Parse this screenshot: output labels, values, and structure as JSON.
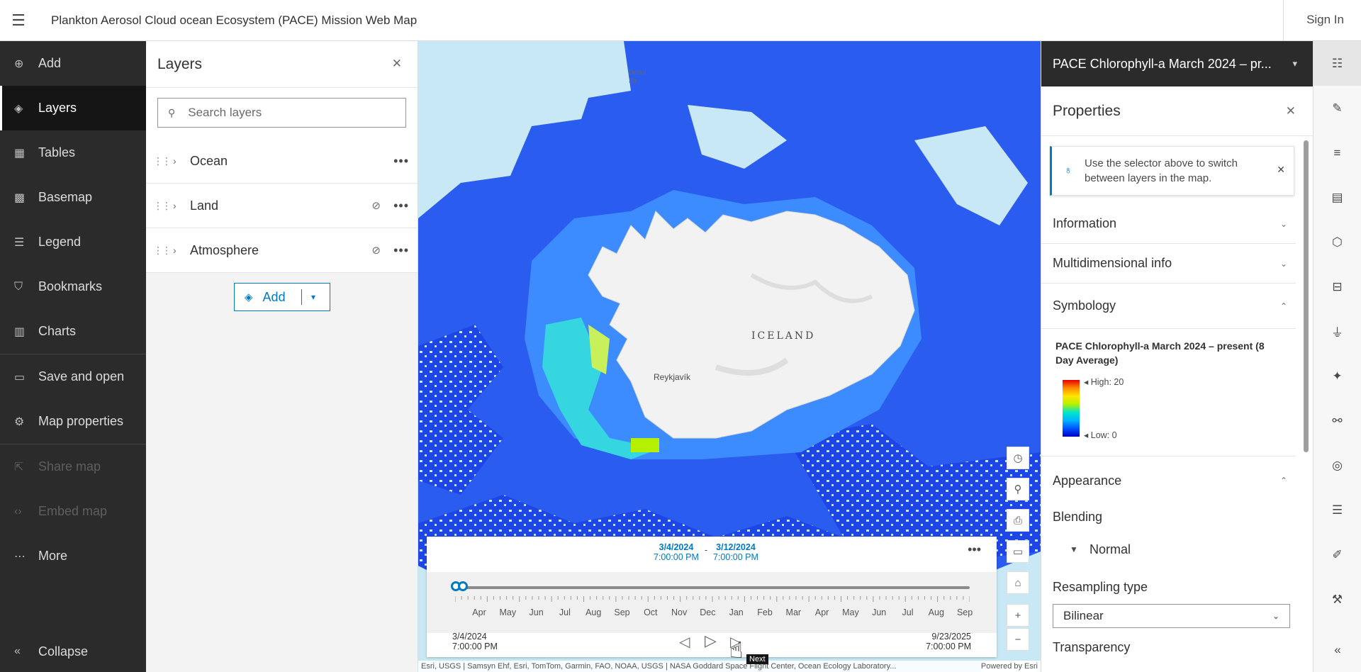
{
  "header": {
    "menu_icon": "hamburger-icon",
    "title": "Plankton Aerosol Cloud ocean Ecosystem (PACE) Mission Web Map",
    "signin": "Sign In"
  },
  "leftnav": {
    "items": [
      {
        "label": "Add",
        "icon": "plus-circle-icon"
      },
      {
        "label": "Layers",
        "icon": "layers-icon",
        "active": true
      },
      {
        "label": "Tables",
        "icon": "table-icon"
      },
      {
        "label": "Basemap",
        "icon": "basemap-icon"
      },
      {
        "label": "Legend",
        "icon": "legend-icon"
      },
      {
        "label": "Bookmarks",
        "icon": "bookmark-icon"
      },
      {
        "label": "Charts",
        "icon": "chart-icon"
      },
      {
        "label": "Save and open",
        "icon": "folder-icon"
      },
      {
        "label": "Map properties",
        "icon": "gear-icon"
      },
      {
        "label": "Share map",
        "icon": "share-icon",
        "disabled": true
      },
      {
        "label": "Embed map",
        "icon": "code-icon",
        "disabled": true
      },
      {
        "label": "More",
        "icon": "ellipsis-icon"
      }
    ],
    "collapse": "Collapse"
  },
  "layers_panel": {
    "title": "Layers",
    "search_placeholder": "Search layers",
    "groups": [
      {
        "name": "Ocean",
        "visible": true
      },
      {
        "name": "Land",
        "visible": false
      },
      {
        "name": "Atmosphere",
        "visible": false
      }
    ],
    "add_label": "Add"
  },
  "map": {
    "labels": {
      "iceland": "ICELAND",
      "reykjavik": "Reykjavík",
      "strait": "Denm Str"
    },
    "attribution": "Esri, USGS | Samsyn Ehf, Esri, TomTom, Garmin, FAO, NOAA, USGS | NASA Goddard Space Flight Center, Ocean Ecology Laboratory...",
    "powered": "Powered by Esri",
    "colors": {
      "ocean": "#c9e8f5",
      "deep": "#1e46e6",
      "mid": "#3c8cff",
      "land": "#f2f2f2"
    }
  },
  "time_slider": {
    "current_start_date": "3/4/2024",
    "current_start_time": "7:00:00 PM",
    "current_end_date": "3/12/2024",
    "current_end_time": "7:00:00 PM",
    "months": [
      "Apr",
      "May",
      "Jun",
      "Jul",
      "Aug",
      "Sep",
      "Oct",
      "Nov",
      "Dec",
      "Jan",
      "Feb",
      "Mar",
      "Apr",
      "May",
      "Jun",
      "Jul",
      "Aug",
      "Sep"
    ],
    "min_date": "3/4/2024",
    "min_time": "7:00:00 PM",
    "max_date": "9/23/2025",
    "max_time": "7:00:00 PM",
    "next_tooltip": "Next"
  },
  "properties": {
    "selector": "PACE Chlorophyll-a March 2024 – pr...",
    "title": "Properties",
    "notice": "Use the selector above to switch between layers in the map.",
    "sections": {
      "information": "Information",
      "multidim": "Multidimensional info",
      "symbology": "Symbology",
      "appearance": "Appearance"
    },
    "legend_title": "PACE Chlorophyll-a March 2024 – present (8 Day Average)",
    "high": "High: 20",
    "low": "Low: 0",
    "blending_label": "Blending",
    "blending_value": "Normal",
    "resampling_label": "Resampling type",
    "resampling_value": "Bilinear",
    "transparency_label": "Transparency"
  },
  "rightbar": {
    "icons": [
      "properties-icon",
      "styles-icon",
      "fields-icon",
      "pop-up-icon",
      "3d-icon",
      "labels-icon",
      "filter-icon",
      "effects-icon",
      "processing-icon",
      "tool-icon",
      "tasks-icon",
      "sketch-icon",
      "wrench-icon"
    ],
    "collapse_icon": "double-chevron-left-icon"
  }
}
